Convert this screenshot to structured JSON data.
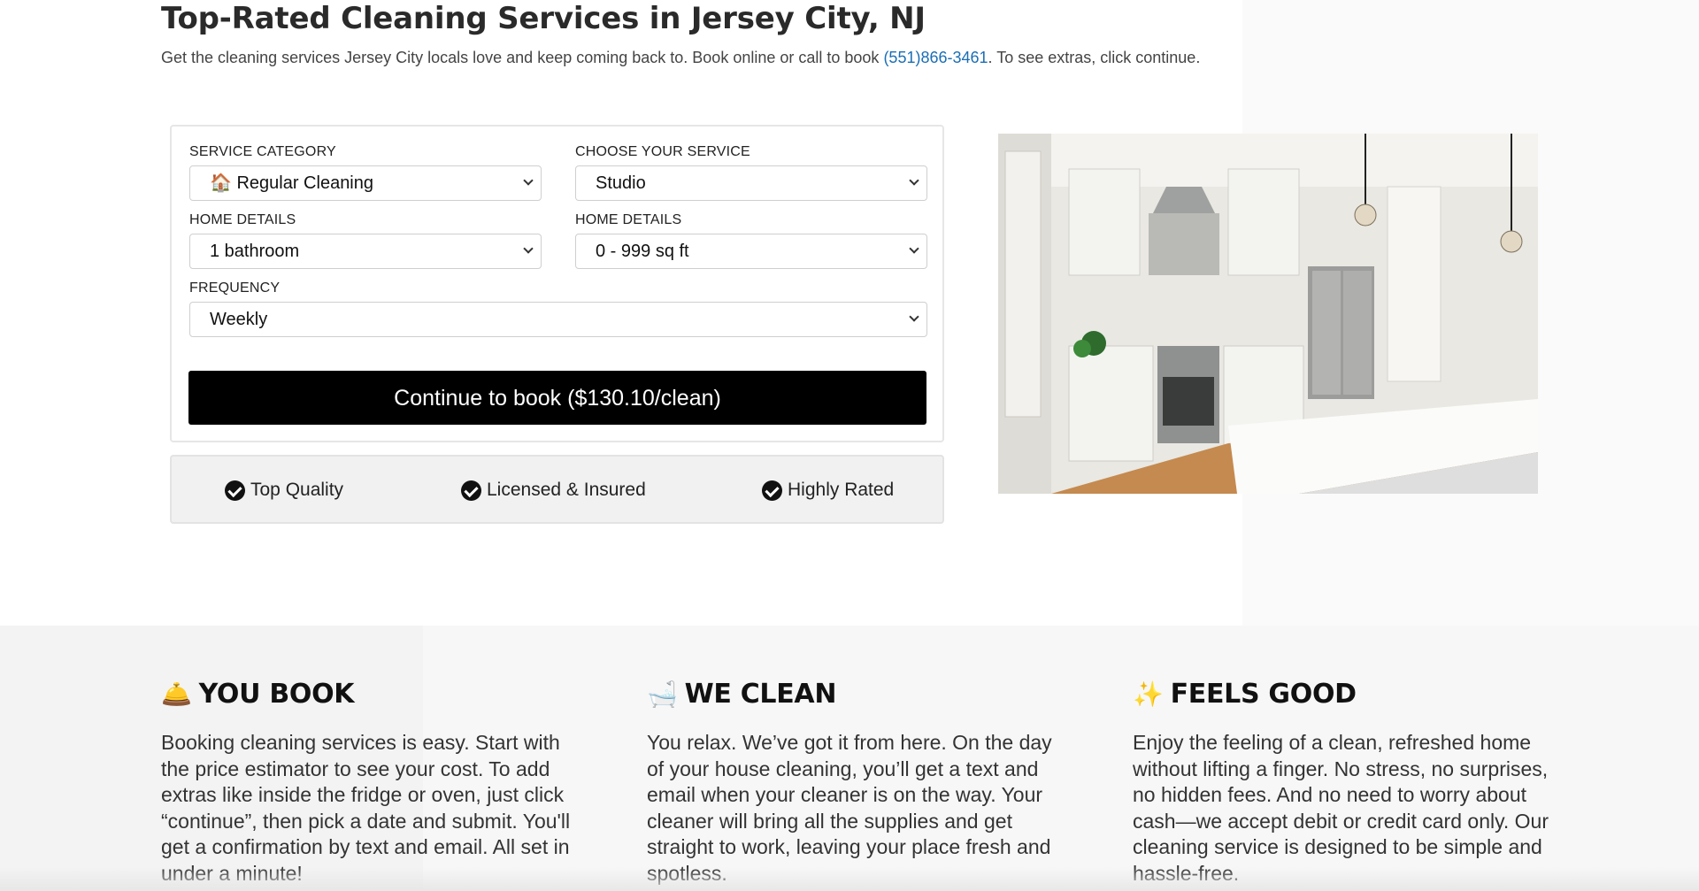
{
  "header": {
    "title": "Top-Rated Cleaning Services in Jersey City, NJ",
    "subtitle_before": "Get the cleaning services Jersey City locals love and keep coming back to. Book online or call to book ",
    "phone": "(551)866-3461",
    "subtitle_after": ". To see extras, click continue."
  },
  "form": {
    "service_category": {
      "label": "SERVICE CATEGORY",
      "value": "🏠 Regular Cleaning"
    },
    "choose_service": {
      "label": "CHOOSE YOUR SERVICE",
      "value": "Studio"
    },
    "home_details_bath": {
      "label": "HOME DETAILS",
      "value": "1 bathroom"
    },
    "home_details_sqft": {
      "label": "HOME DETAILS",
      "value": "0 - 999 sq ft"
    },
    "frequency": {
      "label": "FREQUENCY",
      "value": "Weekly"
    },
    "continue_label": "Continue to book ($130.10/clean)"
  },
  "badges": [
    "Top Quality",
    "Licensed & Insured",
    "Highly Rated"
  ],
  "steps": [
    {
      "emoji": "🛎️",
      "title": "YOU BOOK",
      "text": "Booking cleaning services is easy. Start with the price estimator to see your cost. To add extras like inside the fridge or oven, just click “continue”, then pick a date and submit. You'll get a confirmation by text and email. All set in under a minute!"
    },
    {
      "emoji": "🛁",
      "title": "WE CLEAN",
      "text": "You relax. We’ve got it from here. On the day of your house cleaning, you’ll get a text and email when your cleaner is on the way. Your cleaner will bring all the supplies and get straight to work, leaving your place fresh and spotless."
    },
    {
      "emoji": "✨",
      "title": "FEELS GOOD",
      "text": "Enjoy the feeling of a clean, refreshed home without lifting a finger. No stress, no surprises, no hidden fees. And no need to worry about cash—we accept debit or credit card only. Our cleaning service is designed to be simple and hassle-free."
    }
  ],
  "icons": {
    "check": "check-circle-icon",
    "chevron": "chevron-down-icon"
  }
}
